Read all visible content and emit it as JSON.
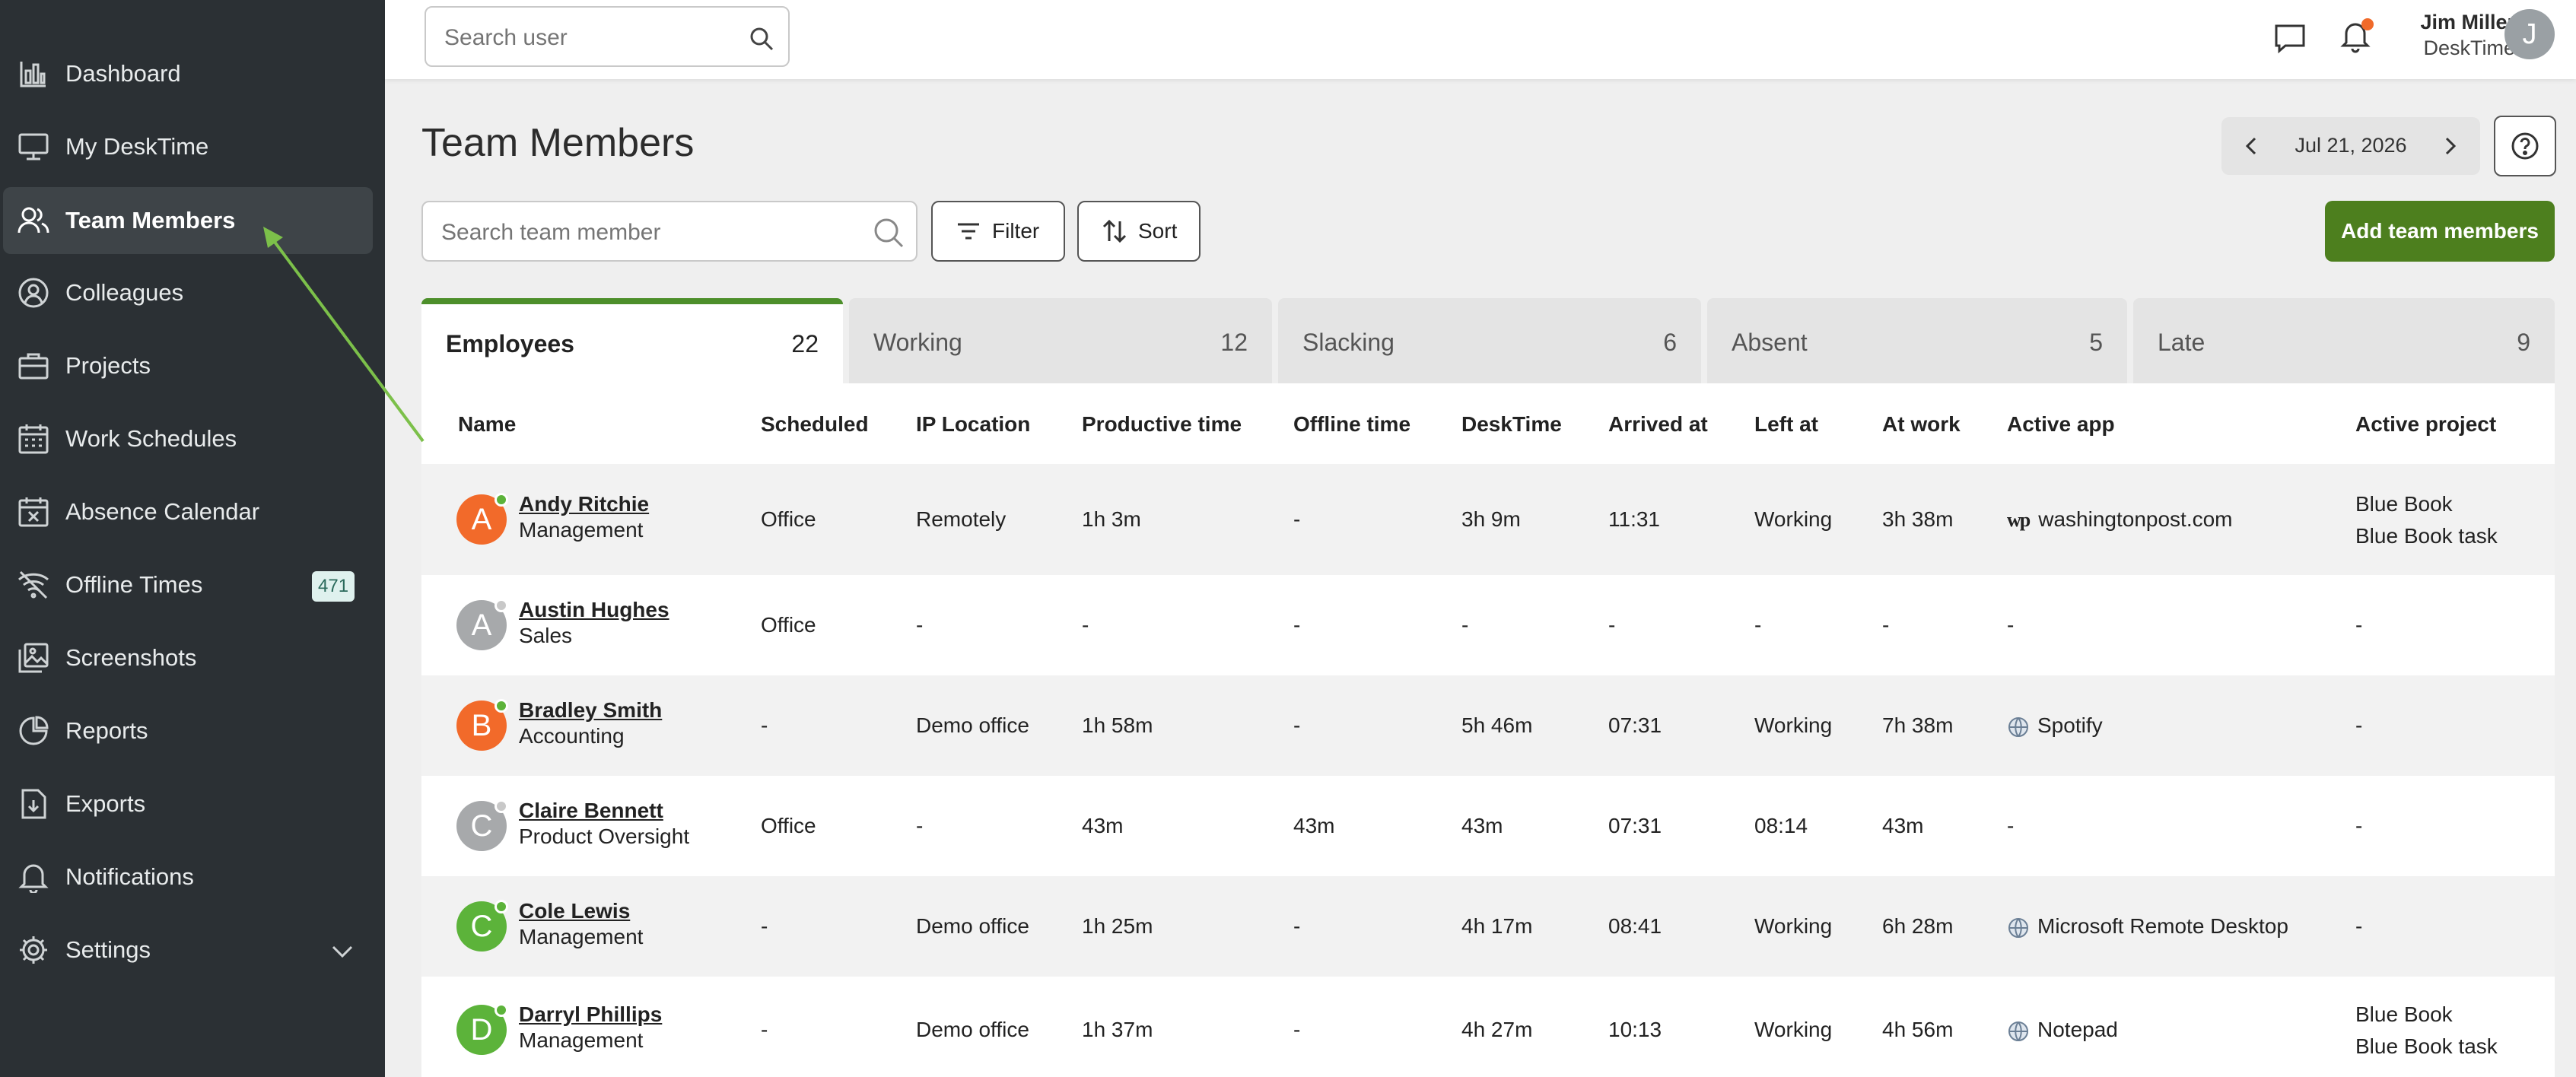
{
  "sidebar": {
    "items": [
      {
        "label": "Dashboard",
        "icon": "bar-chart-icon"
      },
      {
        "label": "My DeskTime",
        "icon": "monitor-icon"
      },
      {
        "label": "Team Members",
        "icon": "users-icon",
        "active": true
      },
      {
        "label": "Colleagues",
        "icon": "user-circle-icon"
      },
      {
        "label": "Projects",
        "icon": "briefcase-icon"
      },
      {
        "label": "Work Schedules",
        "icon": "calendar-icon"
      },
      {
        "label": "Absence Calendar",
        "icon": "calendar-x-icon"
      },
      {
        "label": "Offline Times",
        "icon": "wifi-off-icon",
        "badge": "471"
      },
      {
        "label": "Screenshots",
        "icon": "image-icon"
      },
      {
        "label": "Reports",
        "icon": "pie-chart-icon"
      },
      {
        "label": "Exports",
        "icon": "download-file-icon"
      },
      {
        "label": "Notifications",
        "icon": "bell-icon"
      },
      {
        "label": "Settings",
        "icon": "gear-icon"
      }
    ]
  },
  "topbar": {
    "search_placeholder": "Search user",
    "user_name": "Jim Miller",
    "user_company": "DeskTime",
    "user_initial": "J"
  },
  "page": {
    "title": "Team Members",
    "date": "Jul 21, 2026",
    "search_placeholder": "Search team member",
    "filter_label": "Filter",
    "sort_label": "Sort",
    "add_label": "Add team members"
  },
  "tabs": [
    {
      "label": "Employees",
      "count": "22",
      "active": true
    },
    {
      "label": "Working",
      "count": "12"
    },
    {
      "label": "Slacking",
      "count": "6"
    },
    {
      "label": "Absent",
      "count": "5"
    },
    {
      "label": "Late",
      "count": "9"
    }
  ],
  "table": {
    "columns": [
      "Name",
      "Scheduled",
      "IP Location",
      "Productive time",
      "Offline time",
      "DeskTime",
      "Arrived at",
      "Left at",
      "At work",
      "Active app",
      "Active project"
    ],
    "rows": [
      {
        "initial": "A",
        "avatar_color": "#f26a2a",
        "online": true,
        "name": "Andy Ritchie",
        "dept": "Management",
        "scheduled": "Office",
        "ip": "Remotely",
        "productive": "1h 3m",
        "offline": "-",
        "desktime": "3h 9m",
        "arrived": "11:31",
        "left": "Working",
        "atwork": "3h 38m",
        "app": "washingtonpost.com",
        "app_icon": "washington-post-icon",
        "project": [
          "Blue Book",
          "Blue Book task"
        ]
      },
      {
        "initial": "A",
        "avatar_color": "#a7a9ab",
        "online": false,
        "name": "Austin Hughes",
        "dept": "Sales",
        "scheduled": "Office",
        "ip": "-",
        "productive": "-",
        "offline": "-",
        "desktime": "-",
        "arrived": "-",
        "left": "-",
        "atwork": "-",
        "app": "-",
        "app_icon": "",
        "project": [
          "-"
        ]
      },
      {
        "initial": "B",
        "avatar_color": "#f26a2a",
        "online": true,
        "name": "Bradley Smith",
        "dept": "Accounting",
        "scheduled": "-",
        "ip": "Demo office",
        "productive": "1h 58m",
        "offline": "-",
        "desktime": "5h 46m",
        "arrived": "07:31",
        "left": "Working",
        "atwork": "7h 38m",
        "app": "Spotify",
        "app_icon": "globe-icon",
        "project": [
          "-"
        ]
      },
      {
        "initial": "C",
        "avatar_color": "#a7a9ab",
        "online": false,
        "name": "Claire Bennett",
        "dept": "Product Oversight",
        "scheduled": "Office",
        "ip": "-",
        "productive": "43m",
        "offline": "43m",
        "desktime": "43m",
        "arrived": "07:31",
        "left": "08:14",
        "atwork": "43m",
        "app": "-",
        "app_icon": "",
        "project": [
          "-"
        ]
      },
      {
        "initial": "C",
        "avatar_color": "#5cb33a",
        "online": true,
        "name": "Cole Lewis",
        "dept": "Management",
        "scheduled": "-",
        "ip": "Demo office",
        "productive": "1h 25m",
        "offline": "-",
        "desktime": "4h 17m",
        "arrived": "08:41",
        "left": "Working",
        "atwork": "6h 28m",
        "app": "Microsoft Remote Desktop",
        "app_icon": "globe-icon",
        "project": [
          "-"
        ]
      },
      {
        "initial": "D",
        "avatar_color": "#5cb33a",
        "online": true,
        "name": "Darryl Phillips",
        "dept": "Management",
        "scheduled": "-",
        "ip": "Demo office",
        "productive": "1h 37m",
        "offline": "-",
        "desktime": "4h 27m",
        "arrived": "10:13",
        "left": "Working",
        "atwork": "4h 56m",
        "app": "Notepad",
        "app_icon": "globe-icon",
        "project": [
          "Blue Book",
          "Blue Book task"
        ]
      }
    ]
  },
  "colors": {
    "accent_green": "#4d7f1e",
    "sidebar_bg": "#2b3034",
    "online_dot": "#5cb33a",
    "offline_dot": "#c8c8c8"
  }
}
